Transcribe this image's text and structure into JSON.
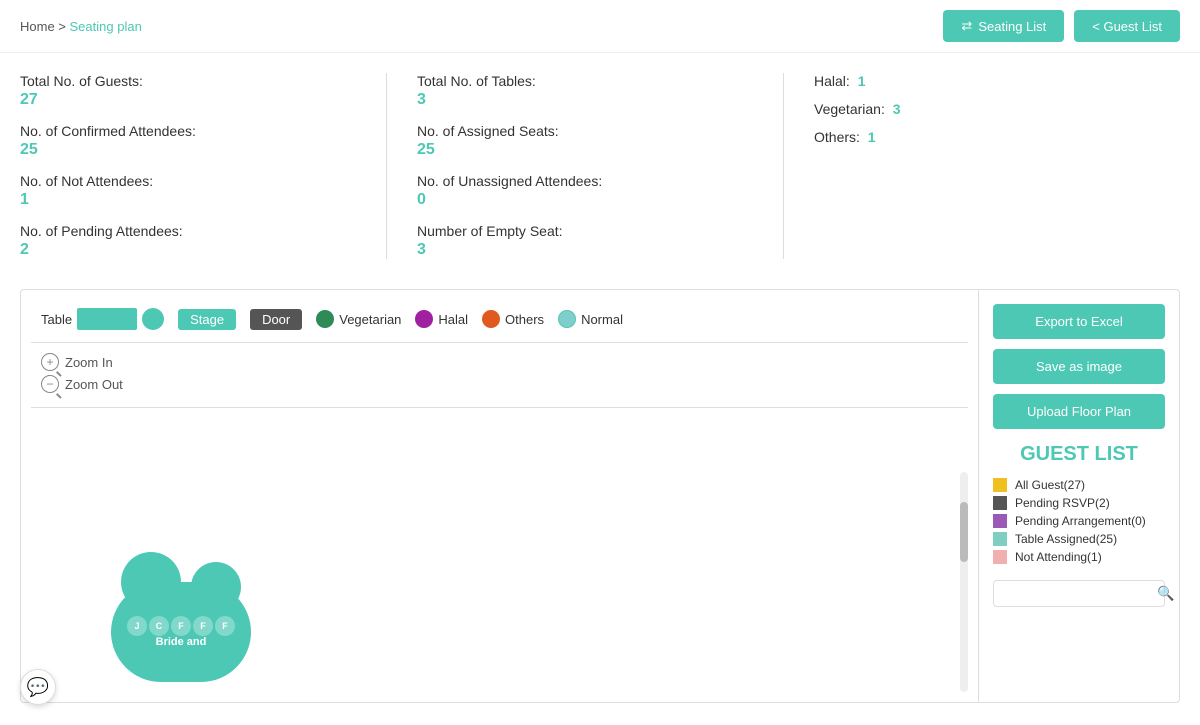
{
  "breadcrumb": {
    "home": "Home",
    "separator": " > ",
    "current": "Seating plan"
  },
  "nav": {
    "seating_list": "Seating List",
    "guest_list": "< Guest List"
  },
  "stats": {
    "col1": {
      "total_guests_label": "Total No. of Guests:",
      "total_guests_value": "27",
      "confirmed_label": "No. of Confirmed Attendees:",
      "confirmed_value": "25",
      "not_attendees_label": "No. of Not Attendees:",
      "not_attendees_value": "1",
      "pending_label": "No. of Pending Attendees:",
      "pending_value": "2"
    },
    "col2": {
      "total_tables_label": "Total No. of Tables:",
      "total_tables_value": "3",
      "assigned_seats_label": "No. of Assigned Seats:",
      "assigned_seats_value": "25",
      "unassigned_label": "No. of Unassigned Attendees:",
      "unassigned_value": "0",
      "empty_seat_label": "Number of Empty Seat:",
      "empty_seat_value": "3"
    },
    "col3": {
      "halal_label": "Halal:",
      "halal_value": "1",
      "vegetarian_label": "Vegetarian:",
      "vegetarian_value": "3",
      "others_label": "Others:",
      "others_value": "1"
    }
  },
  "legend": {
    "table_label": "Table",
    "stage_label": "Stage",
    "door_label": "Door",
    "vegetarian_label": "Vegetarian",
    "halal_label": "Halal",
    "others_label": "Others",
    "normal_label": "Normal"
  },
  "zoom": {
    "zoom_in": "Zoom In",
    "zoom_out": "Zoom Out"
  },
  "actions": {
    "export_excel": "Export to Excel",
    "save_image": "Save as image",
    "upload_floor": "Upload Floor Plan"
  },
  "guest_list": {
    "title": "GUEST LIST",
    "filters": [
      {
        "label": "All Guest(27)",
        "color_class": "fd-yellow"
      },
      {
        "label": "Pending RSVP(2)",
        "color_class": "fd-darkgray"
      },
      {
        "label": "Pending Arrangement(0)",
        "color_class": "fd-purple"
      },
      {
        "label": "Table Assigned(25)",
        "color_class": "fd-teal"
      },
      {
        "label": "Not Attending(1)",
        "color_class": "fd-pink"
      }
    ],
    "search_placeholder": ""
  },
  "floor": {
    "cloud_label": "Bride and",
    "seats": [
      "J",
      "C",
      "F",
      "F",
      "F"
    ]
  }
}
